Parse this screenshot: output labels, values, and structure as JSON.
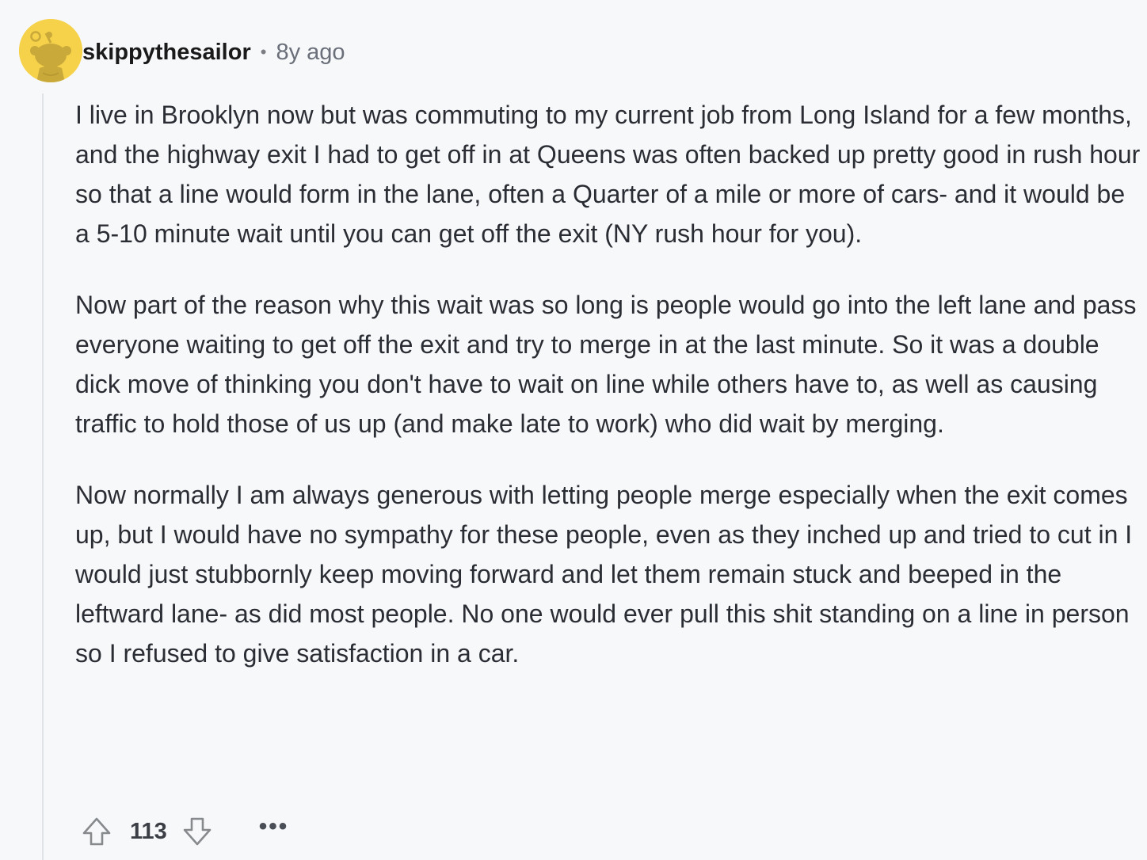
{
  "comment": {
    "username": "skippythesailor",
    "separator": "•",
    "age": "8y ago",
    "paragraphs": [
      "I live in Brooklyn now but was commuting to my current job from Long Island for a few months, and the highway exit I had to get off in at Queens was often backed up pretty good in rush hour so that a line would form in the lane, often a Quarter of a mile or more of cars- and it would be a 5-10 minute wait until you can get off the exit (NY rush hour for you).",
      "Now part of the reason why this wait was so long is people would go into the left lane and pass everyone waiting to get off the exit and try to merge in at the last minute. So it was a double dick move of thinking you don't have to wait on line while others have to, as well as causing traffic to hold those of us up (and make late to work) who did wait by merging.",
      "Now normally I am always generous with letting people merge especially when the exit comes up, but I would have no sympathy for these people, even as they inched up and tried to cut in I would just stubbornly keep moving forward and let them remain stuck and beeped in the leftward lane- as did most people. No one would ever pull this shit standing on a line in person so I refused to give satisfaction in a car."
    ],
    "score": "113",
    "more_label": "•••"
  },
  "icons": {
    "avatar": "snoo-avatar-icon",
    "upvote": "upvote-arrow-icon",
    "downvote": "downvote-arrow-icon",
    "more": "more-options-icon"
  },
  "colors": {
    "background": "#f7f8fa",
    "avatar_bg": "#f6d24a",
    "thread_line": "#dfe3e8",
    "text": "#2a2d33",
    "meta": "#6a6f79"
  }
}
